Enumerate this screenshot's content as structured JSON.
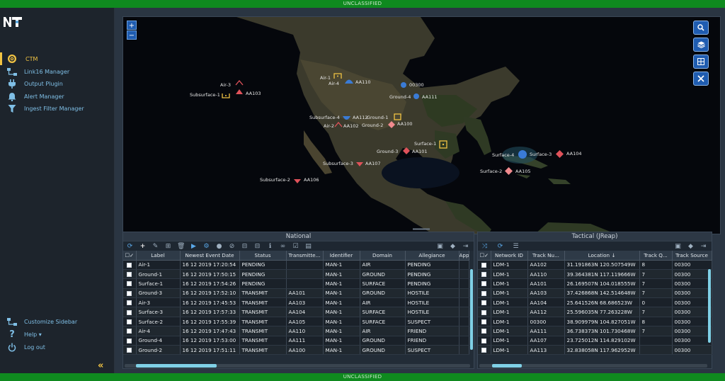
{
  "classification": {
    "top": "UNCLASSIFIED",
    "bottom": "UNCLASSIFIED"
  },
  "sidebar": {
    "logo_icon": "nt-logo-icon",
    "items": [
      {
        "label": "CTM",
        "icon": "ctm-icon",
        "active": true
      },
      {
        "label": "Link16 Manager",
        "icon": "network-icon"
      },
      {
        "label": "Output Plugin",
        "icon": "plug-icon"
      },
      {
        "label": "Alert Manager",
        "icon": "bell-icon"
      },
      {
        "label": "Ingest Filter Manager",
        "icon": "filter-icon"
      }
    ],
    "bottom_items": [
      {
        "label": "Customize Sidebar",
        "icon": "network-icon"
      },
      {
        "label": "Help ▾",
        "icon": "question-icon"
      },
      {
        "label": "Log out",
        "icon": "power-icon"
      }
    ],
    "collapse_label": "«",
    "accent": "#f1c343",
    "link_color": "#7fbfe6"
  },
  "map": {
    "zoom_in": "+",
    "zoom_out": "−",
    "tools": [
      "search-icon",
      "layers-icon",
      "grid-icon",
      "tools-icon"
    ],
    "tracks": [
      {
        "name": "Air-3",
        "id": "",
        "type": "air-hostile"
      },
      {
        "name": "Subsurface-1",
        "id": "AA103",
        "type": "sub-pending"
      },
      {
        "name": "Air-1",
        "id": "",
        "type": "air-pending"
      },
      {
        "name": "Air-4",
        "id": "AA110",
        "type": "air-friend"
      },
      {
        "name": "",
        "id": "00300",
        "type": "friend-dot"
      },
      {
        "name": "Ground-4",
        "id": "AA111",
        "type": "ground-friend"
      },
      {
        "name": "Subsurface-4",
        "id": "AA112",
        "type": "sub-friend"
      },
      {
        "name": "Ground-1",
        "id": "",
        "type": "ground-pending"
      },
      {
        "name": "Air-2",
        "id": "AA102",
        "type": "air-hostile"
      },
      {
        "name": "Ground-2",
        "id": "AA100",
        "type": "ground-suspect"
      },
      {
        "name": "Surface-1",
        "id": "",
        "type": "surface-pending"
      },
      {
        "name": "Ground-3",
        "id": "AA101",
        "type": "ground-hostile"
      },
      {
        "name": "Subsurface-3",
        "id": "AA107",
        "type": "sub-hostile"
      },
      {
        "name": "Subsurface-2",
        "id": "AA106",
        "type": "sub-hostile"
      },
      {
        "name": "Surface-4",
        "id": "",
        "type": "surface-friend"
      },
      {
        "name": "Surface-3",
        "id": "AA104",
        "type": "surface-hostile"
      },
      {
        "name": "Surface-2",
        "id": "AA105",
        "type": "surface-suspect"
      }
    ]
  },
  "national": {
    "title": "National",
    "toolbar_icons": [
      "refresh-icon",
      "add-icon",
      "edit-icon",
      "add-box-icon",
      "delete-icon",
      "play-icon",
      "settings-icon",
      "user-icon",
      "user-off-icon",
      "minus-box-icon",
      "minus-box-icon",
      "info-icon",
      "link-icon",
      "check-box-icon",
      "clipboard-icon",
      "save-icon",
      "eraser-icon",
      "export-icon"
    ],
    "columns": [
      "☐✓",
      "Label",
      "Newest Event Date",
      "Status",
      "Transmitte...",
      "Identifier",
      "Domain",
      "Allegiance",
      "App"
    ],
    "rows": [
      [
        "Air-1",
        "16 12 2019 17:20:54",
        "PENDING",
        "",
        "MAN-1",
        "AIR",
        "PENDING"
      ],
      [
        "Ground-1",
        "16 12 2019 17:50:15",
        "PENDING",
        "",
        "MAN-1",
        "GROUND",
        "PENDING"
      ],
      [
        "Surface-1",
        "16 12 2019 17:54:26",
        "PENDING",
        "",
        "MAN-1",
        "SURFACE",
        "PENDING"
      ],
      [
        "Ground-3",
        "16 12 2019 17:52:10",
        "TRANSMIT",
        "AA101",
        "MAN-1",
        "GROUND",
        "HOSTILE"
      ],
      [
        "Air-3",
        "16 12 2019 17:45:53",
        "TRANSMIT",
        "AA103",
        "MAN-1",
        "AIR",
        "HOSTILE"
      ],
      [
        "Surface-3",
        "16 12 2019 17:57:33",
        "TRANSMIT",
        "AA104",
        "MAN-1",
        "SURFACE",
        "HOSTILE"
      ],
      [
        "Surface-2",
        "16 12 2019 17:55:39",
        "TRANSMIT",
        "AA105",
        "MAN-1",
        "SURFACE",
        "SUSPECT"
      ],
      [
        "Air-4",
        "16 12 2019 17:47:43",
        "TRANSMIT",
        "AA110",
        "MAN-1",
        "AIR",
        "FRIEND"
      ],
      [
        "Ground-4",
        "16 12 2019 17:53:00",
        "TRANSMIT",
        "AA111",
        "MAN-1",
        "GROUND",
        "FRIEND"
      ],
      [
        "Ground-2",
        "16 12 2019 17:51:11",
        "TRANSMIT",
        "AA100",
        "MAN-1",
        "GROUND",
        "SUSPECT"
      ]
    ]
  },
  "tactical": {
    "title": "Tactical (JReap)",
    "toolbar_icons": [
      "shuffle-icon",
      "refresh-icon",
      "list-icon",
      "save-icon",
      "eraser-icon",
      "export-icon"
    ],
    "columns": [
      "☐✓",
      "Network ID",
      "Track Nu...",
      "Location ↓",
      "Track Q...",
      "Track Source"
    ],
    "rows": [
      [
        "LDM-1",
        "AA102",
        "31.191863N 120.507549W",
        "8",
        "00300"
      ],
      [
        "LDM-1",
        "AA110",
        "39.364381N 117.119666W",
        "7",
        "00300"
      ],
      [
        "LDM-1",
        "AA101",
        "26.169507N 104.018555W",
        "7",
        "00300"
      ],
      [
        "LDM-1",
        "AA103",
        "37.426868N 142.514648W",
        "7",
        "00300"
      ],
      [
        "LDM-1",
        "AA104",
        "25.641526N 68.686523W",
        "0",
        "00300"
      ],
      [
        "LDM-1",
        "AA112",
        "25.596035N 77.263228W",
        "7",
        "00300"
      ],
      [
        "LDM-1",
        "00300",
        "38.909979N 104.827051W",
        "8",
        "00300"
      ],
      [
        "LDM-1",
        "AA111",
        "36.738373N 101.730468W",
        "7",
        "00300"
      ],
      [
        "LDM-1",
        "AA107",
        "23.725012N 114.829102W",
        "",
        "00300"
      ],
      [
        "LDM-1",
        "AA113",
        "32.838058N 117.962952W",
        "",
        "00300"
      ]
    ]
  },
  "colors": {
    "hostile": "#e0525a",
    "friend": "#3a7bd5",
    "pending": "#f1c343",
    "suspect": "#f08a8e",
    "classification": "#0f8a1f"
  }
}
